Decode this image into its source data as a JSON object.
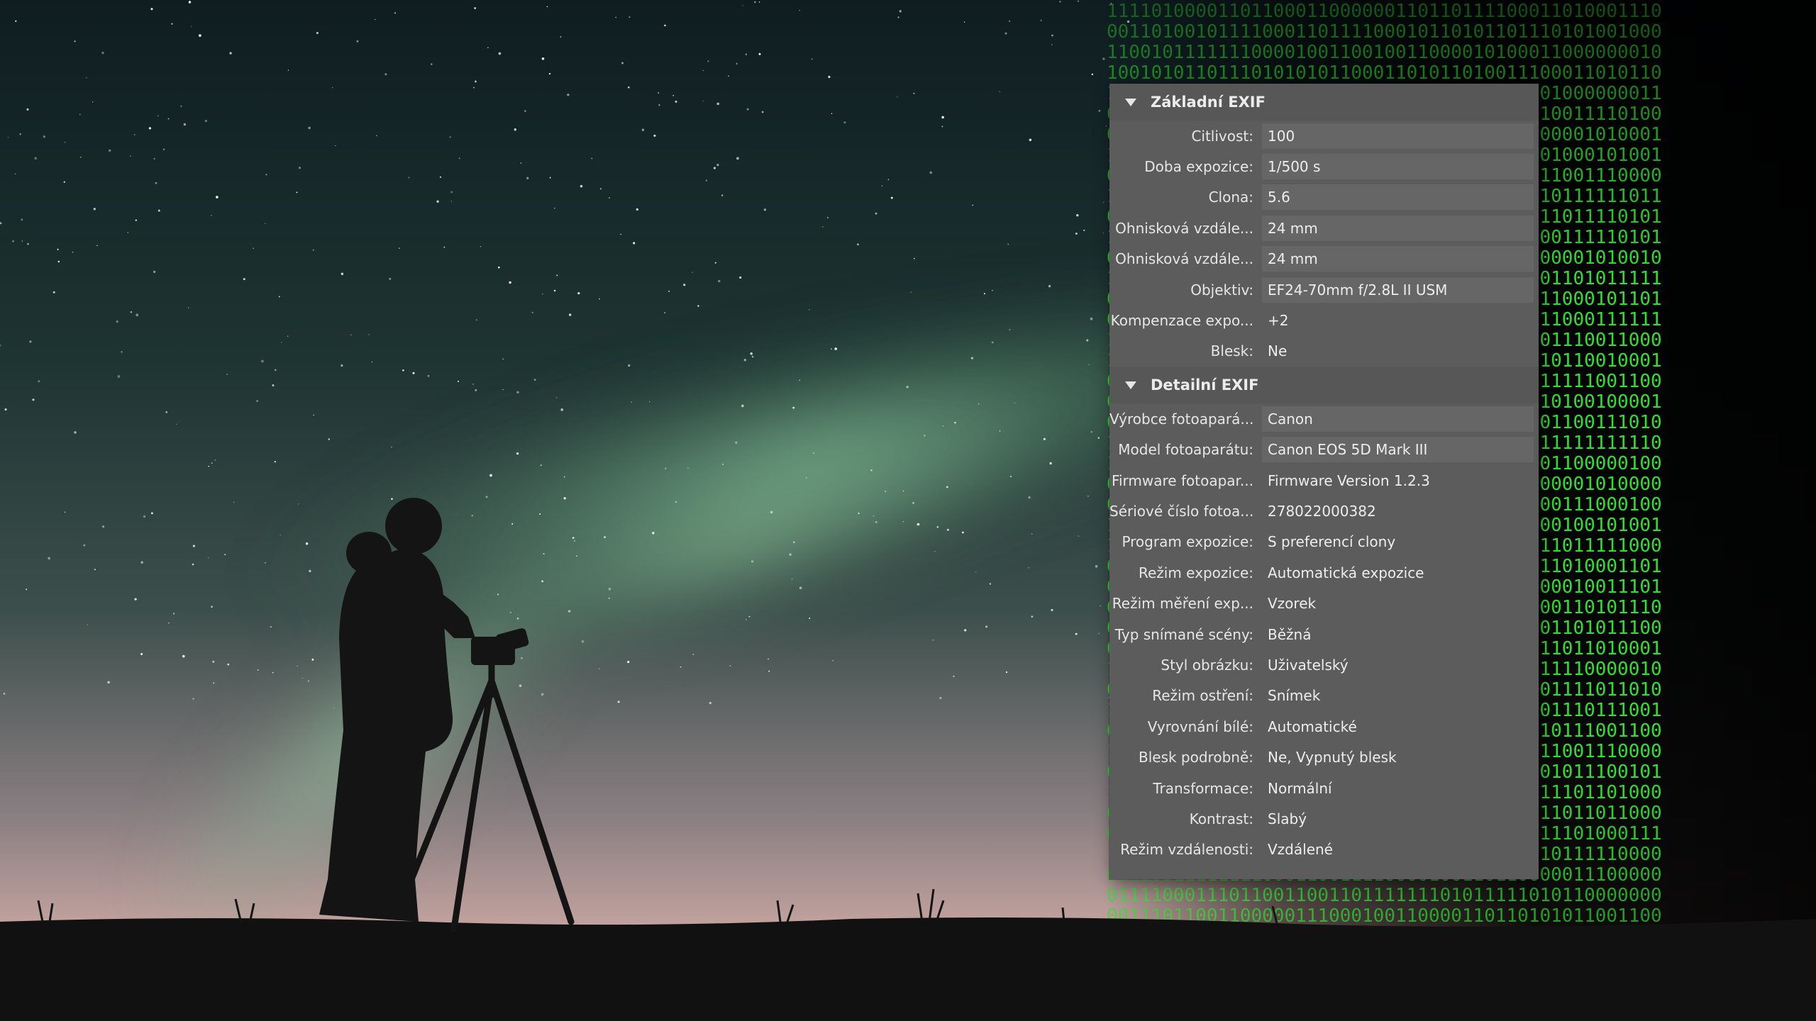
{
  "colors": {
    "panel_bg": "#5c5c5c",
    "section_header_bg": "#575757",
    "field_bg": "#666666",
    "binary_green": "#2fe02f"
  },
  "icons": {
    "section_toggle": "triangle-down-icon"
  },
  "sections": [
    {
      "title": "Základní EXIF",
      "rows": [
        {
          "label": "Citlivost:",
          "value": "100",
          "field": true
        },
        {
          "label": "Doba expozice:",
          "value": "1/500 s",
          "field": true
        },
        {
          "label": "Clona:",
          "value": "5.6",
          "field": true
        },
        {
          "label": "Ohnisková vzdále...",
          "value": "24 mm",
          "field": true
        },
        {
          "label": "Ohnisková vzdále...",
          "value": "24 mm",
          "field": true
        },
        {
          "label": "Objektiv:",
          "value": "EF24-70mm f/2.8L II USM",
          "field": true
        },
        {
          "label": "Kompenzace expo...",
          "value": "+2",
          "field": false
        },
        {
          "label": "Blesk:",
          "value": "Ne",
          "field": false
        }
      ]
    },
    {
      "title": "Detailní EXIF",
      "rows": [
        {
          "label": "Výrobce fotoapará...",
          "value": "Canon",
          "field": true
        },
        {
          "label": "Model fotoaparátu:",
          "value": "Canon EOS 5D Mark III",
          "field": true
        },
        {
          "label": "Firmware fotoapar...",
          "value": "Firmware Version 1.2.3",
          "field": false
        },
        {
          "label": "Sériové číslo fotoa...",
          "value": "278022000382",
          "field": false
        },
        {
          "label": "Program expozice:",
          "value": "S preferencí clony",
          "field": false
        },
        {
          "label": "Režim expozice:",
          "value": "Automatická expozice",
          "field": false
        },
        {
          "label": "Režim měření exp...",
          "value": "Vzorek",
          "field": false
        },
        {
          "label": "Typ snímané scény:",
          "value": "Běžná",
          "field": false
        },
        {
          "label": "Styl obrázku:",
          "value": "Uživatelský",
          "field": false
        },
        {
          "label": "Režim ostření:",
          "value": "Snímek",
          "field": false
        },
        {
          "label": "Vyrovnání bílé:",
          "value": "Automatické",
          "field": false
        },
        {
          "label": "Blesk podrobně:",
          "value": "Ne, Vypnutý blesk",
          "field": false
        },
        {
          "label": "Transformace:",
          "value": "Normální",
          "field": false
        },
        {
          "label": "Kontrast:",
          "value": "Slabý",
          "field": false
        },
        {
          "label": "Režim vzdálenosti:",
          "value": "Vzdálené",
          "field": false
        }
      ]
    }
  ]
}
